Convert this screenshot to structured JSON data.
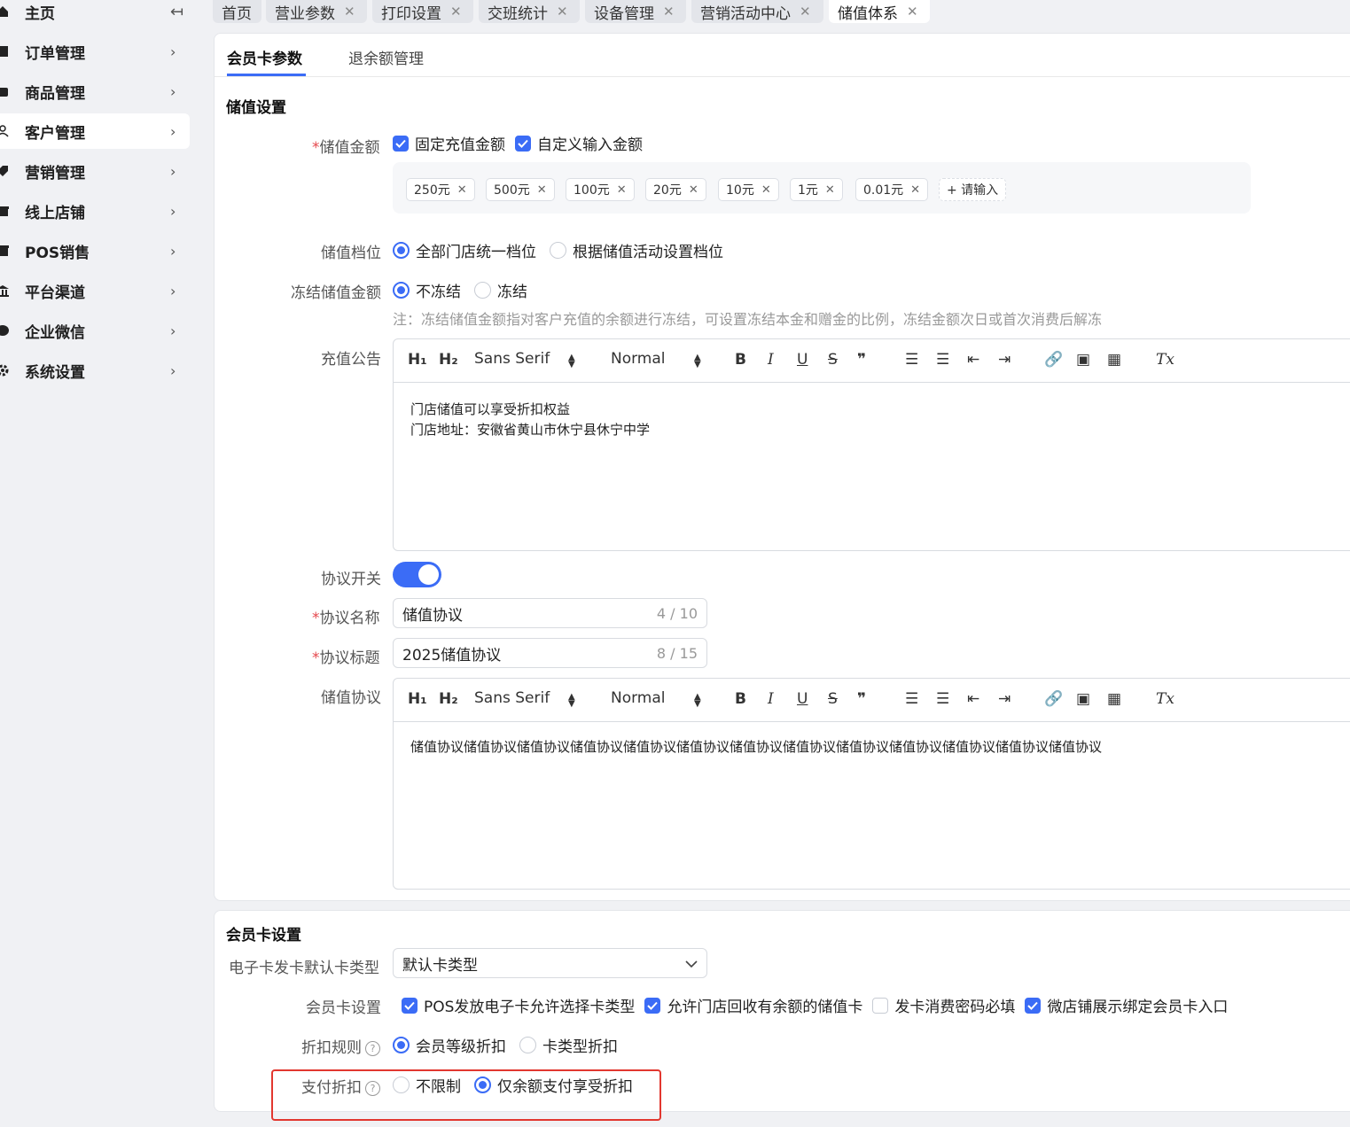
{
  "sidebar": {
    "items": [
      {
        "label": "主页",
        "icon": "home-icon",
        "chev": "↤"
      },
      {
        "label": "订单管理",
        "icon": "order-icon",
        "chev": "›"
      },
      {
        "label": "商品管理",
        "icon": "product-icon",
        "chev": "›"
      },
      {
        "label": "客户管理",
        "icon": "customer-icon",
        "chev": "›"
      },
      {
        "label": "营销管理",
        "icon": "marketing-icon",
        "chev": "›"
      },
      {
        "label": "线上店铺",
        "icon": "store-icon",
        "chev": "›"
      },
      {
        "label": "POS销售",
        "icon": "pos-icon",
        "chev": "›"
      },
      {
        "label": "平台渠道",
        "icon": "channel-icon",
        "chev": "›"
      },
      {
        "label": "企业微信",
        "icon": "wechat-icon",
        "chev": "›"
      },
      {
        "label": "系统设置",
        "icon": "gear-icon",
        "chev": "›"
      }
    ]
  },
  "tabs": [
    {
      "label": "首页"
    },
    {
      "label": "营业参数",
      "close": "✕"
    },
    {
      "label": "打印设置",
      "close": "✕"
    },
    {
      "label": "交班统计",
      "close": "✕"
    },
    {
      "label": "设备管理",
      "close": "✕"
    },
    {
      "label": "营销活动中心",
      "close": "✕"
    },
    {
      "label": "储值体系",
      "close": "✕"
    }
  ],
  "subtabs": {
    "member_card": "会员卡参数",
    "refund": "退余额管理"
  },
  "stored_value": {
    "section_title": "储值设置",
    "amount_label": "储值金额",
    "required_mark": "*",
    "fixed_amount": "固定充值金额",
    "custom_amount": "自定义输入金额",
    "tags": [
      "250元",
      "500元",
      "100元",
      "20元",
      "10元",
      "1元",
      "0.01元"
    ],
    "add_tag": "+ 请输入",
    "tier_label": "储值档位",
    "tier_options": [
      "全部门店统一档位",
      "根据储值活动设置档位"
    ],
    "freeze_label": "冻结储值金额",
    "freeze_options": [
      "不冻结",
      "冻结"
    ],
    "freeze_note": "注：冻结储值金额指对客户充值的余额进行冻结，可设置冻结本金和赠金的比例，冻结金额次日或首次消费后解冻",
    "notice_label": "充值公告",
    "notice_lines": [
      "门店储值可以享受折扣权益",
      "门店地址：安徽省黄山市休宁县休宁中学"
    ],
    "agreement_switch_label": "协议开关",
    "agreement_name_label": "协议名称",
    "agreement_name_value": "储值协议",
    "agreement_name_count": "4 / 10",
    "agreement_title_label": "协议标题",
    "agreement_title_value": "2025储值协议",
    "agreement_title_count": "8 / 15",
    "agreement_label": "储值协议",
    "agreement_text": "储值协议储值协议储值协议储值协议储值协议储值协议储值协议储值协议储值协议储值协议储值协议储值协议储值协议"
  },
  "editor_toolbar": {
    "h1": "H₁",
    "h2": "H₂",
    "font": "Sans Serif",
    "size": "Normal",
    "bold": "B",
    "italic": "I",
    "underline": "U",
    "strike": "S",
    "quote": "❞",
    "ol": "☰",
    "ul": "☰",
    "outdent": "⇤",
    "indent": "⇥",
    "link": "🔗",
    "image": "▣",
    "video": "▦",
    "clear": "Tx"
  },
  "member_card": {
    "section_title": "会员卡设置",
    "default_type_label": "电子卡发卡默认卡类型",
    "default_type_value": "默认卡类型",
    "settings_label": "会员卡设置",
    "settings_options": [
      "POS发放电子卡允许选择卡类型",
      "允许门店回收有余额的储值卡",
      "发卡消费密码必填",
      "微店铺展示绑定会员卡入口"
    ],
    "discount_rule_label": "折扣规则",
    "discount_rule_options": [
      "会员等级折扣",
      "卡类型折扣"
    ],
    "pay_discount_label": "支付折扣",
    "pay_discount_options": [
      "不限制",
      "仅余额支付享受折扣"
    ],
    "help_mark": "?"
  },
  "colors": {
    "accent": "#3b6cf6",
    "highlight": "#e2372f",
    "required": "#e5484d"
  }
}
